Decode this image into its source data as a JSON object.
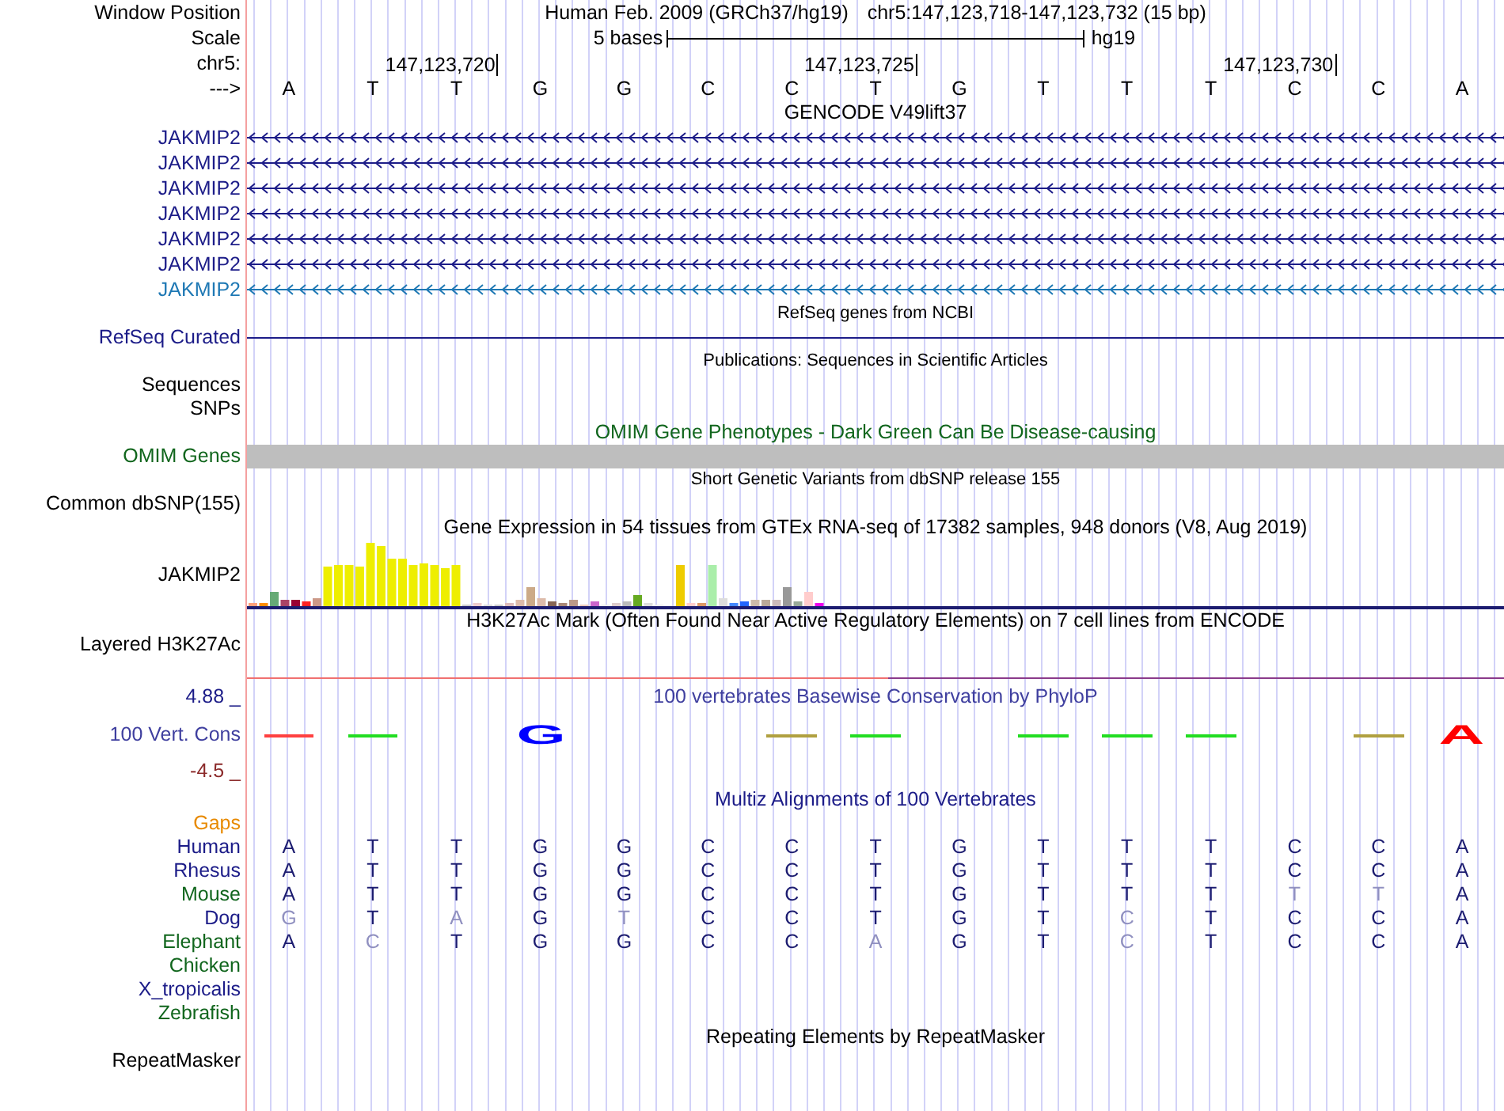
{
  "position": {
    "label": "Window Position",
    "assembly": "Human Feb. 2009 (GRCh37/hg19)",
    "range": "chr5:147,123,718-147,123,732 (15 bp)"
  },
  "scale": {
    "label": "Scale",
    "span": "5 bases",
    "assembly": "hg19"
  },
  "ruler": {
    "label": "chr5:",
    "ticks": [
      "147,123,720",
      "147,123,725",
      "147,123,730"
    ]
  },
  "sequence": {
    "label": "--->",
    "bases": [
      "A",
      "T",
      "T",
      "G",
      "G",
      "C",
      "C",
      "T",
      "G",
      "T",
      "T",
      "T",
      "C",
      "C",
      "A"
    ]
  },
  "tracks": [
    {
      "kind": "genes",
      "title": "GENCODE V49lift37",
      "genes": [
        {
          "name": "JAKMIP2",
          "color": "#1c1c88"
        },
        {
          "name": "JAKMIP2",
          "color": "#1c1c88"
        },
        {
          "name": "JAKMIP2",
          "color": "#1c1c88"
        },
        {
          "name": "JAKMIP2",
          "color": "#1c1c88"
        },
        {
          "name": "JAKMIP2",
          "color": "#1c1c88"
        },
        {
          "name": "JAKMIP2",
          "color": "#1c1c88"
        },
        {
          "name": "JAKMIP2",
          "color": "#1e78b4"
        }
      ]
    },
    {
      "kind": "line",
      "title": "RefSeq genes from NCBI",
      "label": "RefSeq Curated"
    },
    {
      "kind": "empty",
      "title": "Publications: Sequences in Scientific Articles",
      "labels": [
        "Sequences",
        "SNPs"
      ]
    },
    {
      "kind": "bar",
      "title": "OMIM Gene Phenotypes - Dark Green Can Be Disease-causing",
      "label": "OMIM Genes"
    },
    {
      "kind": "empty",
      "title": "Short Genetic Variants from dbSNP release 155",
      "labels": [
        "Common dbSNP(155)"
      ]
    },
    {
      "kind": "expression",
      "title": "Gene Expression in 54 tissues from GTEx RNA-seq of 17382 samples, 948 donors (V8, Aug 2019)",
      "label": "JAKMIP2"
    },
    {
      "kind": "signal",
      "title": "H3K27Ac Mark (Often Found Near Active Regulatory Elements) on 7 cell lines from ENCODE",
      "label": "Layered H3K27Ac"
    },
    {
      "kind": "conservation",
      "title": "100 vertebrates Basewise Conservation by PhyloP",
      "label": "100 Vert. Cons",
      "max": "4.88 _",
      "min": "-4.5 _",
      "marks": [
        {
          "kind": "dash",
          "color": "#ff4040"
        },
        {
          "kind": "dash",
          "color": "#22dd22"
        },
        {
          "kind": "blank"
        },
        {
          "kind": "letter",
          "text": "G",
          "color": "#0000ff"
        },
        {
          "kind": "blank"
        },
        {
          "kind": "blank"
        },
        {
          "kind": "dash",
          "color": "#b0a040"
        },
        {
          "kind": "dash",
          "color": "#22dd22"
        },
        {
          "kind": "blank"
        },
        {
          "kind": "dash",
          "color": "#22dd22"
        },
        {
          "kind": "dash",
          "color": "#22dd22"
        },
        {
          "kind": "dash",
          "color": "#22dd22"
        },
        {
          "kind": "blank"
        },
        {
          "kind": "dash",
          "color": "#b0a040"
        },
        {
          "kind": "letter",
          "text": "A",
          "color": "#ff0000"
        }
      ]
    },
    {
      "kind": "alignment",
      "title": "Multiz Alignments of 100 Vertebrates",
      "gaps": "Gaps",
      "species": [
        {
          "name": "Human",
          "color": "#1c1c88",
          "bases": [
            {
              "letter": "A",
              "faded": false
            },
            {
              "letter": "T",
              "faded": false
            },
            {
              "letter": "T",
              "faded": false
            },
            {
              "letter": "G",
              "faded": false
            },
            {
              "letter": "G",
              "faded": false
            },
            {
              "letter": "C",
              "faded": false
            },
            {
              "letter": "C",
              "faded": false
            },
            {
              "letter": "T",
              "faded": false
            },
            {
              "letter": "G",
              "faded": false
            },
            {
              "letter": "T",
              "faded": false
            },
            {
              "letter": "T",
              "faded": false
            },
            {
              "letter": "T",
              "faded": false
            },
            {
              "letter": "C",
              "faded": false
            },
            {
              "letter": "C",
              "faded": false
            },
            {
              "letter": "A",
              "faded": false
            }
          ]
        },
        {
          "name": "Rhesus",
          "color": "#1c1c88",
          "bases": [
            {
              "letter": "A",
              "faded": false
            },
            {
              "letter": "T",
              "faded": false
            },
            {
              "letter": "T",
              "faded": false
            },
            {
              "letter": "G",
              "faded": false
            },
            {
              "letter": "G",
              "faded": false
            },
            {
              "letter": "C",
              "faded": false
            },
            {
              "letter": "C",
              "faded": false
            },
            {
              "letter": "T",
              "faded": false
            },
            {
              "letter": "G",
              "faded": false
            },
            {
              "letter": "T",
              "faded": false
            },
            {
              "letter": "T",
              "faded": false
            },
            {
              "letter": "T",
              "faded": false
            },
            {
              "letter": "C",
              "faded": false
            },
            {
              "letter": "C",
              "faded": false
            },
            {
              "letter": "A",
              "faded": false
            }
          ]
        },
        {
          "name": "Mouse",
          "color": "#11661d",
          "bases": [
            {
              "letter": "A",
              "faded": false
            },
            {
              "letter": "T",
              "faded": false
            },
            {
              "letter": "T",
              "faded": false
            },
            {
              "letter": "G",
              "faded": false
            },
            {
              "letter": "G",
              "faded": false
            },
            {
              "letter": "C",
              "faded": false
            },
            {
              "letter": "C",
              "faded": false
            },
            {
              "letter": "T",
              "faded": false
            },
            {
              "letter": "G",
              "faded": false
            },
            {
              "letter": "T",
              "faded": false
            },
            {
              "letter": "T",
              "faded": false
            },
            {
              "letter": "T",
              "faded": false
            },
            {
              "letter": "T",
              "faded": true
            },
            {
              "letter": "T",
              "faded": true
            },
            {
              "letter": "A",
              "faded": false
            }
          ]
        },
        {
          "name": "Dog",
          "color": "#1c1c88",
          "bases": [
            {
              "letter": "G",
              "faded": true
            },
            {
              "letter": "T",
              "faded": false
            },
            {
              "letter": "A",
              "faded": true
            },
            {
              "letter": "G",
              "faded": false
            },
            {
              "letter": "T",
              "faded": true
            },
            {
              "letter": "C",
              "faded": false
            },
            {
              "letter": "C",
              "faded": false
            },
            {
              "letter": "T",
              "faded": false
            },
            {
              "letter": "G",
              "faded": false
            },
            {
              "letter": "T",
              "faded": false
            },
            {
              "letter": "C",
              "faded": true
            },
            {
              "letter": "T",
              "faded": false
            },
            {
              "letter": "C",
              "faded": false
            },
            {
              "letter": "C",
              "faded": false
            },
            {
              "letter": "A",
              "faded": false
            }
          ]
        },
        {
          "name": "Elephant",
          "color": "#11661d",
          "bases": [
            {
              "letter": "A",
              "faded": false
            },
            {
              "letter": "C",
              "faded": true
            },
            {
              "letter": "T",
              "faded": false
            },
            {
              "letter": "G",
              "faded": false
            },
            {
              "letter": "G",
              "faded": false
            },
            {
              "letter": "C",
              "faded": false
            },
            {
              "letter": "C",
              "faded": false
            },
            {
              "letter": "A",
              "faded": true
            },
            {
              "letter": "G",
              "faded": false
            },
            {
              "letter": "T",
              "faded": false
            },
            {
              "letter": "C",
              "faded": true
            },
            {
              "letter": "T",
              "faded": false
            },
            {
              "letter": "C",
              "faded": false
            },
            {
              "letter": "C",
              "faded": false
            },
            {
              "letter": "A",
              "faded": false
            }
          ]
        },
        {
          "name": "Chicken",
          "color": "#11661d"
        },
        {
          "name": "X_tropicalis",
          "color": "#1c1c88"
        },
        {
          "name": "Zebrafish",
          "color": "#11661d"
        }
      ]
    },
    {
      "kind": "rmsk",
      "title": "Repeating Elements by RepeatMasker",
      "labels": [
        "RepeatMasker"
      ]
    }
  ]
}
